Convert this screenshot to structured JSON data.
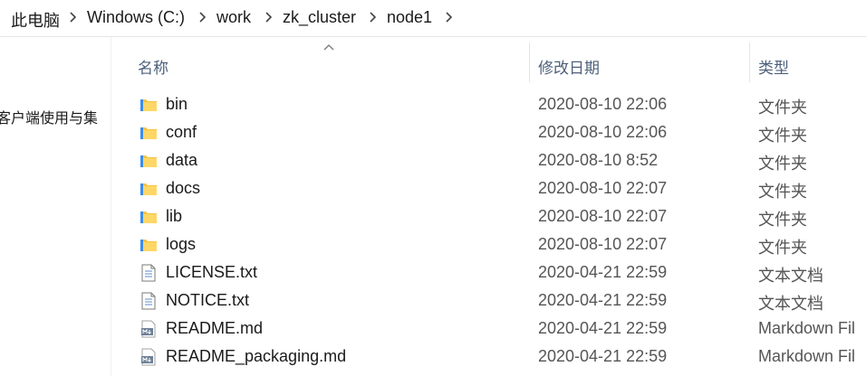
{
  "breadcrumb": [
    "此电脑",
    "Windows (C:)",
    "work",
    "zk_cluster",
    "node1"
  ],
  "nav": {
    "partial_item": "客户端使用与集"
  },
  "columns": {
    "name": "名称",
    "modified": "修改日期",
    "type": "类型"
  },
  "files": [
    {
      "name": "bin",
      "modified": "2020-08-10 22:06",
      "type": "文件夹",
      "icon": "folder-icon"
    },
    {
      "name": "conf",
      "modified": "2020-08-10 22:06",
      "type": "文件夹",
      "icon": "folder-icon"
    },
    {
      "name": "data",
      "modified": "2020-08-10 8:52",
      "type": "文件夹",
      "icon": "folder-icon"
    },
    {
      "name": "docs",
      "modified": "2020-08-10 22:07",
      "type": "文件夹",
      "icon": "folder-icon"
    },
    {
      "name": "lib",
      "modified": "2020-08-10 22:07",
      "type": "文件夹",
      "icon": "folder-icon"
    },
    {
      "name": "logs",
      "modified": "2020-08-10 22:07",
      "type": "文件夹",
      "icon": "folder-icon"
    },
    {
      "name": "LICENSE.txt",
      "modified": "2020-04-21 22:59",
      "type": "文本文档",
      "icon": "text-file-icon"
    },
    {
      "name": "NOTICE.txt",
      "modified": "2020-04-21 22:59",
      "type": "文本文档",
      "icon": "text-file-icon"
    },
    {
      "name": "README.md",
      "modified": "2020-04-21 22:59",
      "type": "Markdown Fil",
      "icon": "markdown-file-icon"
    },
    {
      "name": "README_packaging.md",
      "modified": "2020-04-21 22:59",
      "type": "Markdown Fil",
      "icon": "markdown-file-icon"
    }
  ],
  "colors": {
    "folder": "#f5c242",
    "header_text": "#4c607a",
    "text": "#1a1a1a"
  }
}
